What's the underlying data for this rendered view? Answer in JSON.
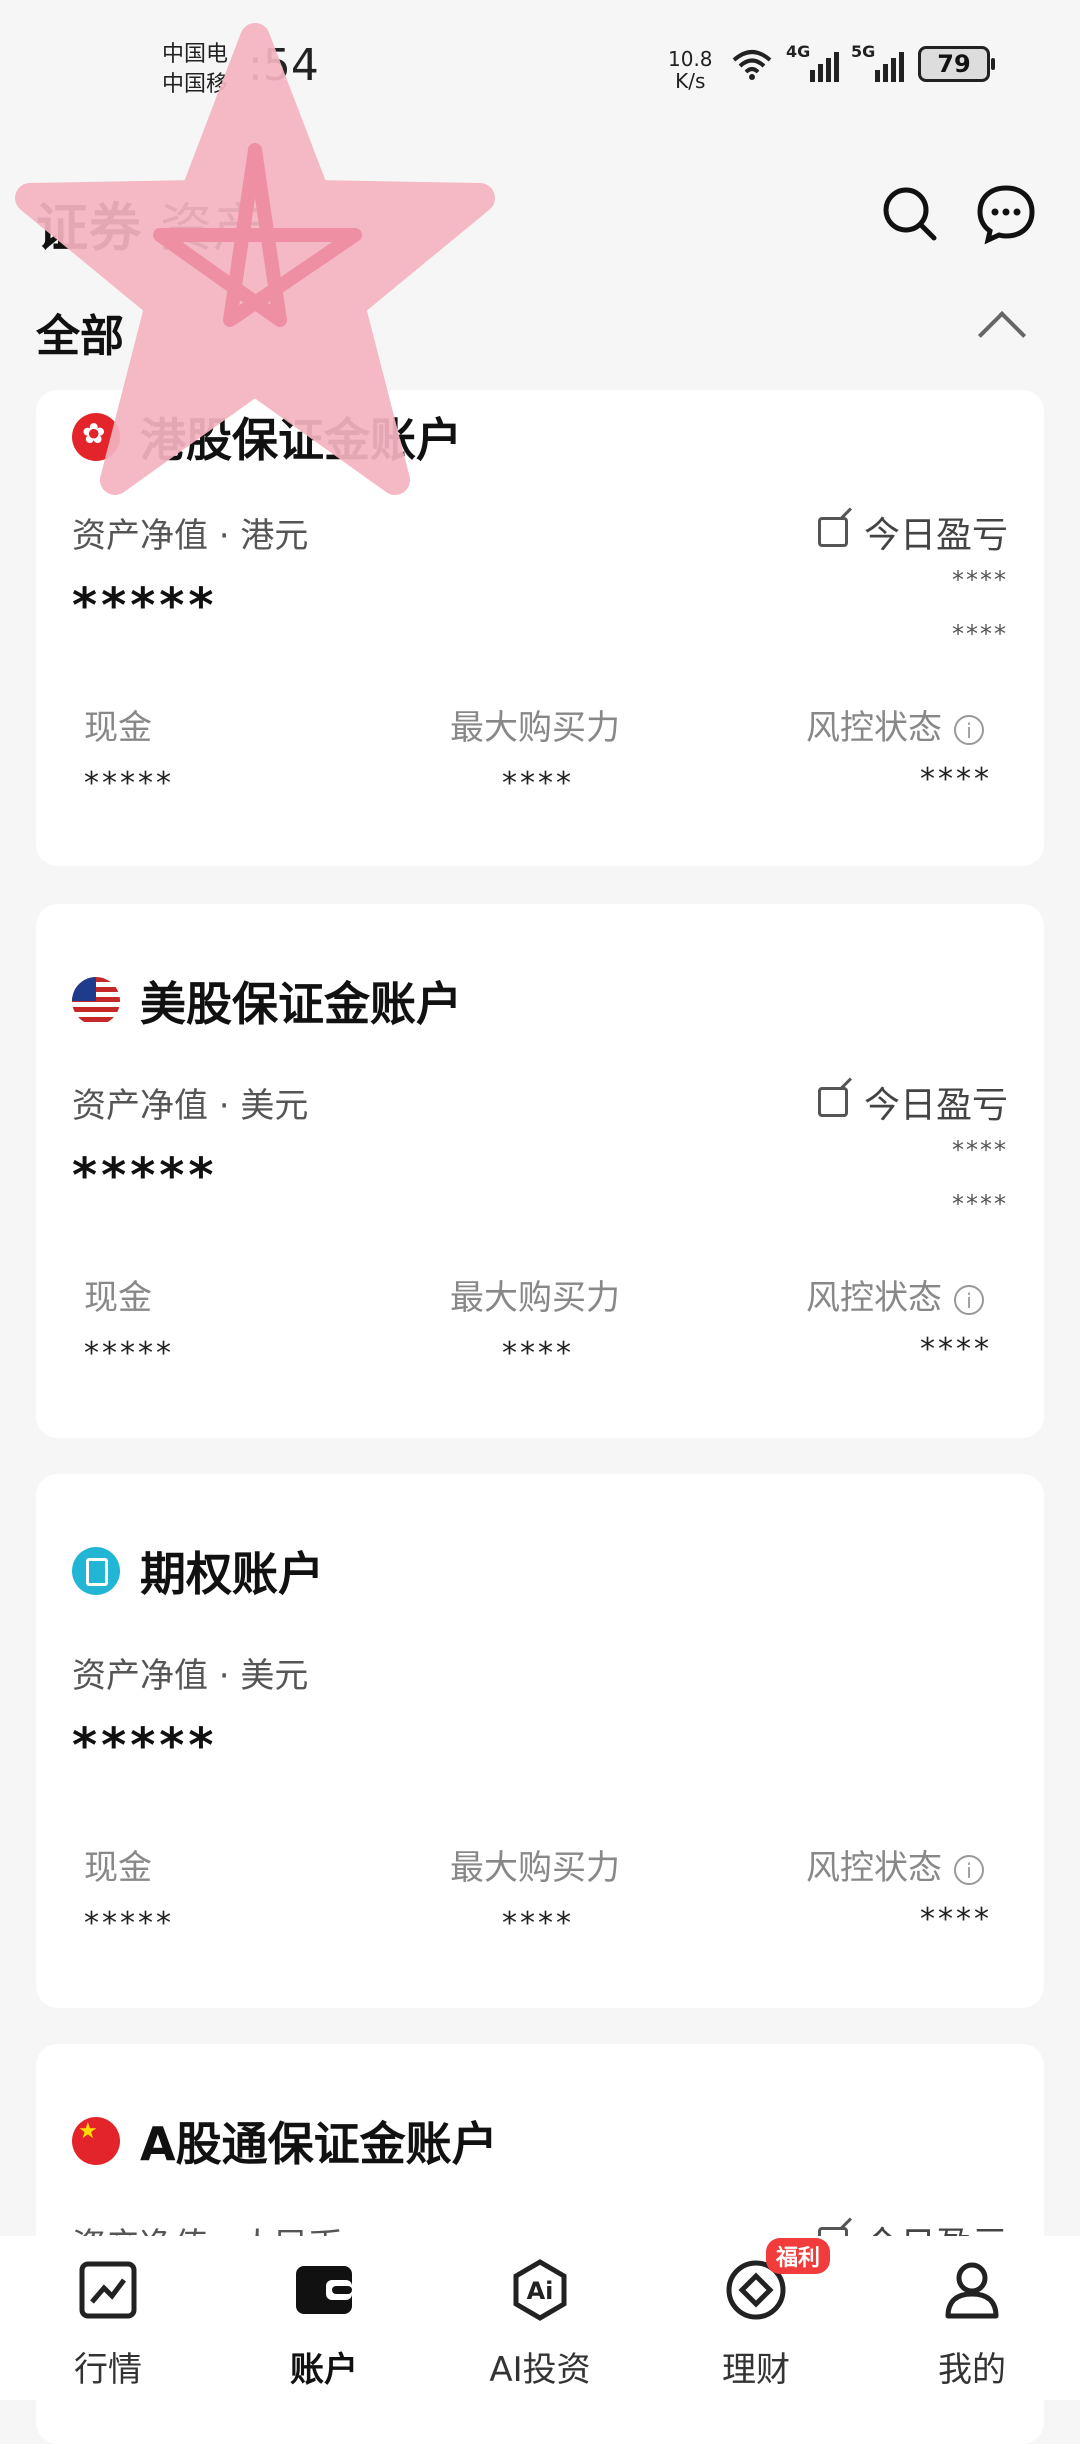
{
  "status_bar": {
    "carrier_line1": "中国电",
    "carrier_line2": "中国移",
    "time": ":54",
    "net_speed_value": "10.8",
    "net_speed_unit": "K/s",
    "signal1_tag": "4G",
    "signal2_tag": "5G",
    "battery": "79"
  },
  "header": {
    "title": "证券",
    "title_suffix": "资产",
    "filter_label": "全部"
  },
  "accounts": [
    {
      "title": "港股保证金账户",
      "nav_label": "资产净值 · 港元",
      "nav_value": "*****",
      "pnl_label": "今日盈亏",
      "pnl_value1": "****",
      "pnl_value2": "****",
      "cash_label": "现金",
      "cash_value": "*****",
      "bp_label": "最大购买力",
      "bp_value": "****",
      "risk_label": "风控状态",
      "risk_value": "****"
    },
    {
      "title": "美股保证金账户",
      "nav_label": "资产净值 · 美元",
      "nav_value": "*****",
      "pnl_label": "今日盈亏",
      "pnl_value1": "****",
      "pnl_value2": "****",
      "cash_label": "现金",
      "cash_value": "*****",
      "bp_label": "最大购买力",
      "bp_value": "****",
      "risk_label": "风控状态",
      "risk_value": "****"
    },
    {
      "title": "期权账户",
      "nav_label": "资产净值 · 美元",
      "nav_value": "*****",
      "cash_label": "现金",
      "cash_value": "*****",
      "bp_label": "最大购买力",
      "bp_value": "****",
      "risk_label": "风控状态",
      "risk_value": "****"
    },
    {
      "title": "A股通保证金账户",
      "nav_label": "资产净值 · 人民币",
      "pnl_label": "今日盈亏"
    }
  ],
  "bottom_nav": {
    "items": [
      {
        "label": "行情",
        "icon": "chart-trend-icon"
      },
      {
        "label": "账户",
        "icon": "wallet-icon"
      },
      {
        "label": "AI投资",
        "icon": "ai-icon"
      },
      {
        "label": "理财",
        "icon": "wealth-icon"
      },
      {
        "label": "我的",
        "icon": "person-icon"
      }
    ],
    "badge": "福利"
  },
  "colors": {
    "background": "#f6f6f6",
    "card": "#ffffff",
    "badge": "#f23b3b",
    "sticker": "#f4a5b5"
  }
}
